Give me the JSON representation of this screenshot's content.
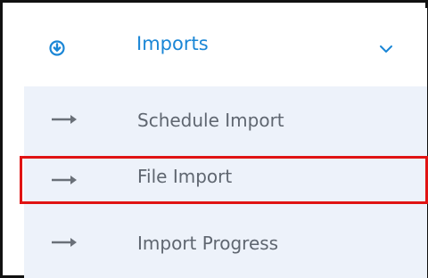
{
  "menu": {
    "header_label": "Imports",
    "header_icon": "download-circle-icon",
    "expand_icon": "chevron-down-icon",
    "accent_color": "#1a86d6",
    "items": [
      {
        "label": "Schedule Import",
        "icon": "arrow-right-icon"
      },
      {
        "label": "File Import",
        "icon": "arrow-right-icon",
        "highlighted": true
      },
      {
        "label": "Import Progress",
        "icon": "arrow-right-icon"
      }
    ],
    "highlight_color": "#e01313",
    "submenu_background": "#edf2fa"
  }
}
